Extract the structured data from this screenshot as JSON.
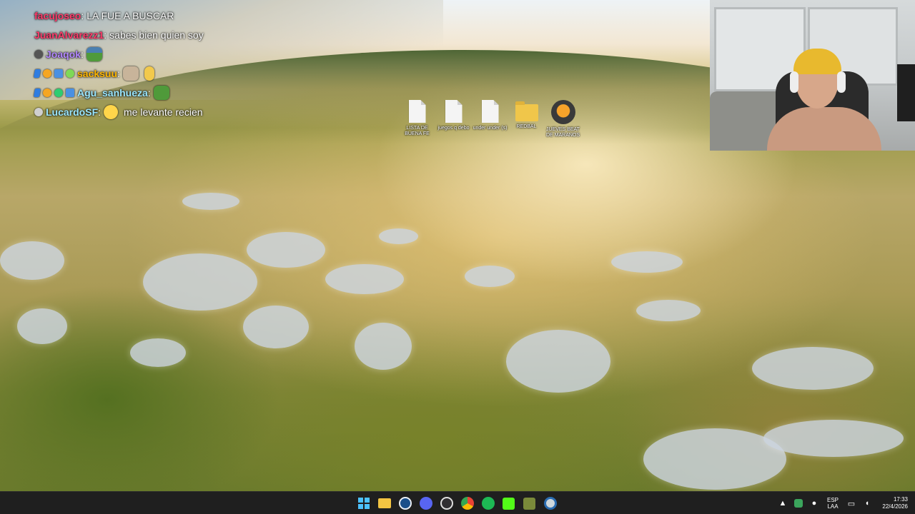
{
  "chat": {
    "messages": [
      {
        "username": "facujoseo",
        "user_color": "#ff3b6b",
        "text": "LA FUE A BUSCAR",
        "badges": [],
        "emotes": []
      },
      {
        "username": "JuanAlvarezz1",
        "user_color": "#ff3b6b",
        "text": "sabes bien quien soy",
        "badges": [],
        "emotes": []
      },
      {
        "username": "Joaqok",
        "user_color": "#b388ff",
        "text": "",
        "badges": [
          "skull-badge"
        ],
        "emotes": [
          "pepe-hat-emote"
        ]
      },
      {
        "username": "sacksuu",
        "user_color": "#ffb703",
        "text": "",
        "badges": [
          "verified-badge",
          "sub-badge",
          "gift-badge",
          "alien-badge"
        ],
        "emotes": [
          "cat-emote",
          "wave-hand-emote"
        ]
      },
      {
        "username": "Agu_sanhueza",
        "user_color": "#9be7ff",
        "text": "",
        "badges": [
          "verified-badge",
          "sub-badge",
          "bits-badge",
          "gift-badge"
        ],
        "emotes": [
          "pepe-emote"
        ]
      },
      {
        "username": "LucardoSF",
        "user_color": "#9be7ff",
        "text": "me levante recien",
        "badges": [
          "moon-badge"
        ],
        "emotes": [
          "neutral-face-emote"
        ]
      }
    ]
  },
  "desktop": {
    "icons": [
      {
        "label": "LISTA DE BUENA FE",
        "type": "file"
      },
      {
        "label": "juegos q debo",
        "type": "file"
      },
      {
        "label": "under under (s)",
        "type": "file"
      },
      {
        "label": "REDBAL",
        "type": "folder"
      },
      {
        "label": "JUEVES BEAT DE MARANOS",
        "type": "fl-studio"
      }
    ]
  },
  "webcam": {
    "scene": "streamer-camera"
  },
  "taskbar": {
    "apps": [
      {
        "name": "start",
        "icon": "windows-start-icon"
      },
      {
        "name": "file-explorer",
        "icon": "folder-icon",
        "color": "#f4c542"
      },
      {
        "name": "steam",
        "icon": "steam-icon",
        "color": "#1b4f8a"
      },
      {
        "name": "discord",
        "icon": "discord-icon",
        "color": "#5865f2"
      },
      {
        "name": "obs",
        "icon": "obs-icon",
        "color": "#302e31"
      },
      {
        "name": "chrome",
        "icon": "chrome-icon",
        "color": "#4285f4"
      },
      {
        "name": "spotify",
        "icon": "spotify-icon",
        "color": "#1db954"
      },
      {
        "name": "kick",
        "icon": "kick-icon",
        "color": "#53fc18"
      },
      {
        "name": "game",
        "icon": "game-icon",
        "color": "#7a8a3a"
      },
      {
        "name": "ccleaner",
        "icon": "ccleaner-icon",
        "color": "#cfd8dc"
      }
    ],
    "tray": {
      "language_line1": "ESP",
      "language_line2": "LAA",
      "time": "17:33",
      "date": "22/4/2026"
    }
  }
}
